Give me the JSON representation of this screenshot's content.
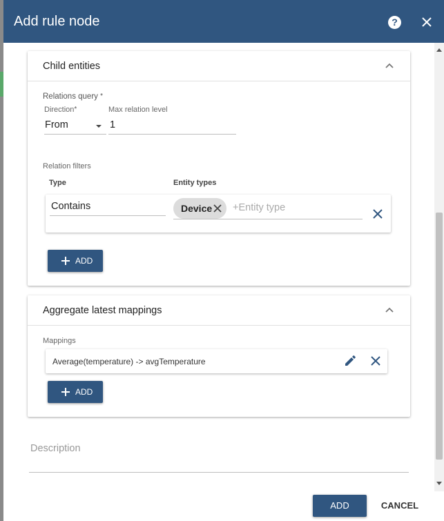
{
  "dialog": {
    "title": "Add rule node",
    "help_icon": "help-circle-icon",
    "close_icon": "close-icon"
  },
  "child_entities": {
    "title": "Child entities",
    "relations_query_label": "Relations query",
    "required_mark": "*",
    "direction_label": "Direction",
    "direction_value": "From",
    "max_level_label": "Max relation level",
    "max_level_value": "1",
    "relation_filters_label": "Relation filters",
    "col_type": "Type",
    "col_entity_types": "Entity types",
    "filter_row": {
      "type_value": "Contains",
      "chip_label": "Device",
      "entity_type_placeholder": "+Entity type"
    },
    "add_label": "ADD"
  },
  "aggregate": {
    "title": "Aggregate latest mappings",
    "mappings_label": "Mappings",
    "mapping_text": "Average(temperature) -> avgTemperature",
    "add_label": "ADD"
  },
  "description": {
    "placeholder": "Description"
  },
  "footer": {
    "add_label": "ADD",
    "cancel_label": "CANCEL"
  },
  "colors": {
    "primary": "#305680",
    "header_text": "#ffffff"
  }
}
